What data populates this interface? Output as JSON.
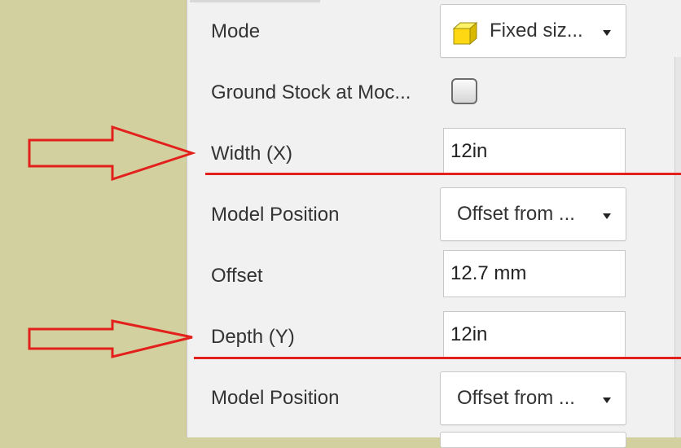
{
  "colors": {
    "background": "#d3d09f",
    "panel": "#f1f1f1",
    "annotation": "#e2201c"
  },
  "rows": {
    "mode": {
      "label": "Mode",
      "value": "Fixed siz...",
      "icon": "stock-cube-icon"
    },
    "ground_stock": {
      "label": "Ground Stock at Moc..."
    },
    "width": {
      "label": "Width (X)",
      "value": "12in"
    },
    "model_position_1": {
      "label": "Model Position",
      "value": "Offset from ..."
    },
    "offset": {
      "label": "Offset",
      "value": "12.7 mm"
    },
    "depth": {
      "label": "Depth (Y)",
      "value": "12in"
    },
    "model_position_2": {
      "label": "Model Position",
      "value": "Offset from ..."
    }
  }
}
